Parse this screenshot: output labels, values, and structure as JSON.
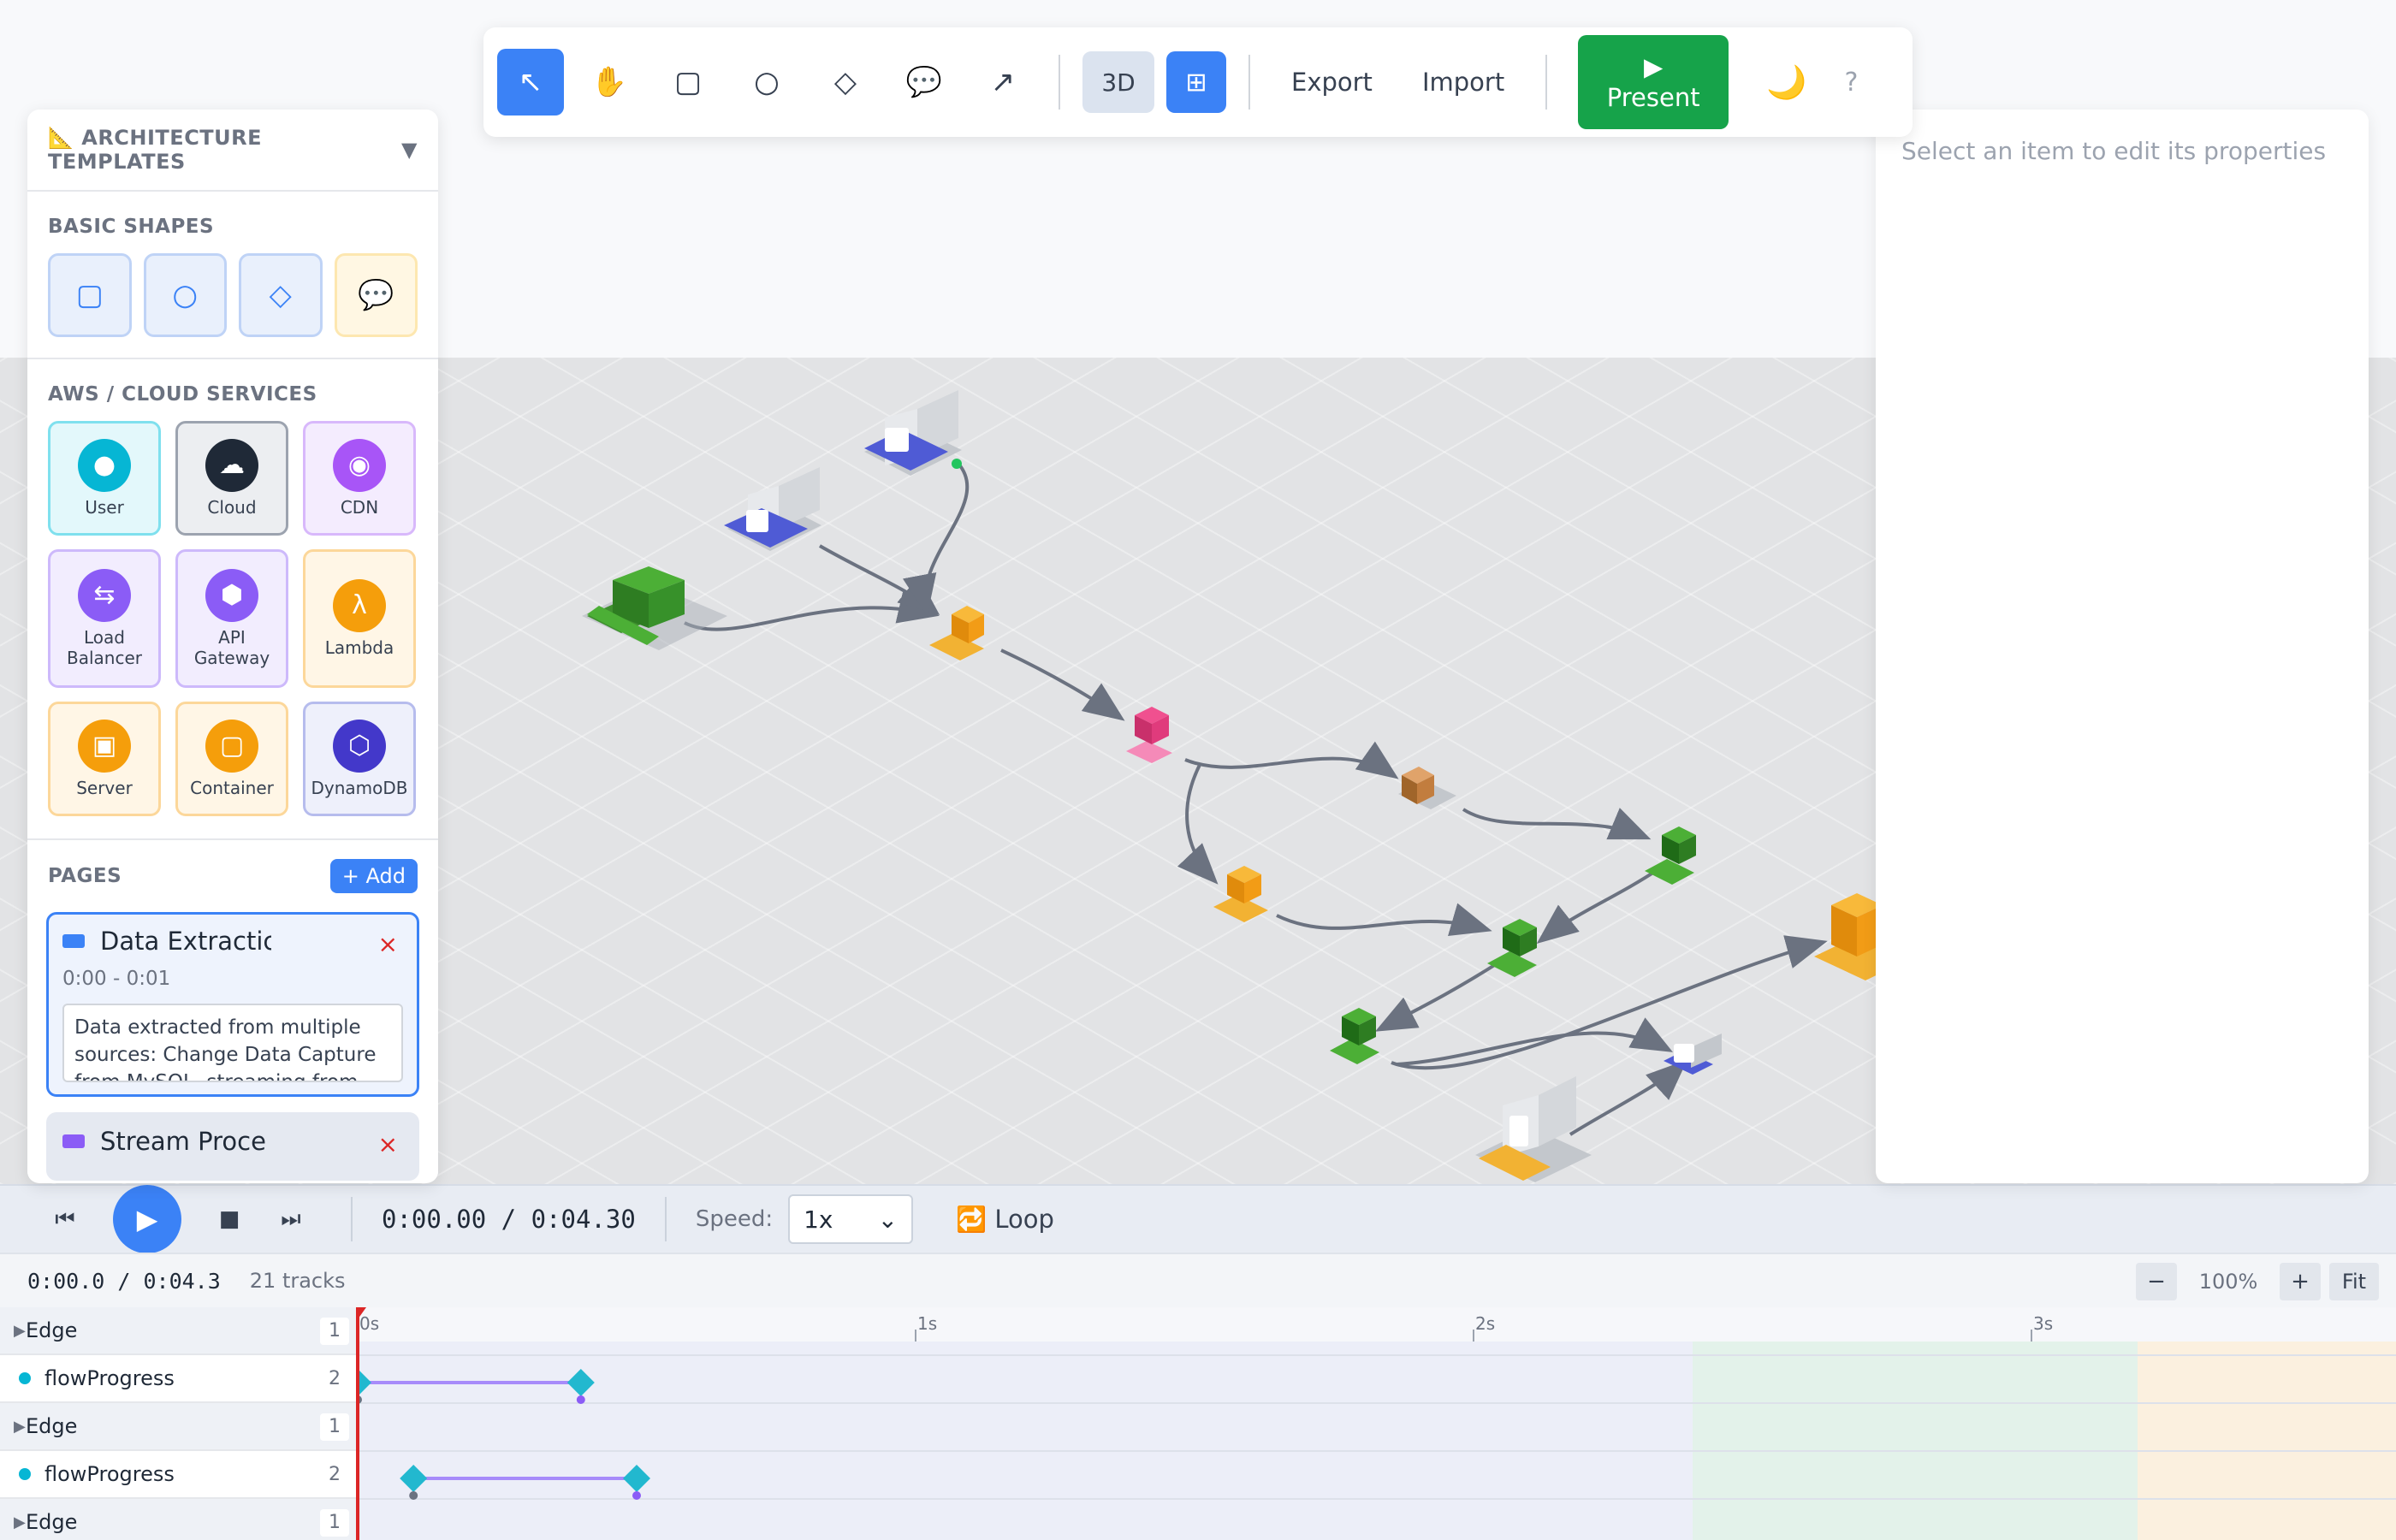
{
  "toolbar": {
    "tools": [
      {
        "name": "select-tool",
        "icon": "↖",
        "active": true
      },
      {
        "name": "pan-tool",
        "icon": "✋",
        "active": false
      },
      {
        "name": "rectangle-tool",
        "icon": "▢",
        "active": false
      },
      {
        "name": "circle-tool",
        "icon": "○",
        "active": false
      },
      {
        "name": "diamond-tool",
        "icon": "◇",
        "active": false
      },
      {
        "name": "note-tool",
        "icon": "💬",
        "active": false
      },
      {
        "name": "arrow-tool",
        "icon": "↗",
        "active": false
      }
    ],
    "view_3d": "3D",
    "grid_icon": "⊞",
    "export": "Export",
    "import": "Import",
    "present_icon": "▶",
    "present": "Present",
    "theme_icon": "🌙",
    "help": "?"
  },
  "left_panel": {
    "header": "📐 ARCHITECTURE TEMPLATES",
    "header_toggle": "▼",
    "basic_shapes_title": "BASIC SHAPES",
    "basic_shapes": [
      "▢",
      "○",
      "◇",
      "💬"
    ],
    "services_title": "AWS / CLOUD SERVICES",
    "services": [
      {
        "label": "User",
        "icon": "●",
        "color": "#06b6d4",
        "bg": "#e3f8fb",
        "border": "#7fe0ee"
      },
      {
        "label": "Cloud",
        "icon": "☁",
        "color": "#1f2937",
        "bg": "#eceef1",
        "border": "#9ca3af"
      },
      {
        "label": "CDN",
        "icon": "◉",
        "color": "#a855f7",
        "bg": "#f4ecfe",
        "border": "#d8b8fb"
      },
      {
        "label": "Load Balancer",
        "icon": "⇆",
        "color": "#8b5cf6",
        "bg": "#f2edfe",
        "border": "#cdb9fb"
      },
      {
        "label": "API Gateway",
        "icon": "⬢",
        "color": "#8b5cf6",
        "bg": "#f2edfe",
        "border": "#cdb9fb"
      },
      {
        "label": "Lambda",
        "icon": "λ",
        "color": "#f59e0b",
        "bg": "#fff6e6",
        "border": "#fcd79a"
      },
      {
        "label": "Server",
        "icon": "▣",
        "color": "#f59e0b",
        "bg": "#fff6e6",
        "border": "#fcd79a"
      },
      {
        "label": "Container",
        "icon": "▢",
        "color": "#f59e0b",
        "bg": "#fff6e6",
        "border": "#fcd79a"
      },
      {
        "label": "DynamoDB",
        "icon": "⬡",
        "color": "#4338ca",
        "bg": "#eef0fb",
        "border": "#b6bced"
      }
    ],
    "pages_title": "PAGES",
    "add_label": "+ Add",
    "pages": [
      {
        "title": "Data Extractic",
        "time": "0:00 - 0:01",
        "color": "#3b82f6",
        "description": "Data extracted from multiple sources: Change Data Capture from MySQL, streaming from",
        "close": "×"
      },
      {
        "title": "Stream Proce",
        "color": "#8b5cf6",
        "close": "×"
      }
    ]
  },
  "right_panel": {
    "hint": "Select an item to edit its properties"
  },
  "playback": {
    "skip_back": "⏮",
    "play": "▶",
    "stop": "■",
    "skip_forward": "⏭",
    "time": "0:00.00 / 0:04.30",
    "speed_label": "Speed:",
    "speed_value": "1x",
    "loop": "🔁 Loop"
  },
  "timeline": {
    "time": "0:00.0 / 0:04.3",
    "tracks": "21 tracks",
    "zoom_out": "−",
    "zoom": "100%",
    "zoom_in": "+",
    "fit": "Fit",
    "ticks": [
      "0s",
      "1s",
      "2s",
      "3s"
    ],
    "rows": [
      {
        "label": "Edge",
        "count": "1",
        "kind": "group"
      },
      {
        "label": "flowProgress",
        "count": "2",
        "kind": "prop"
      },
      {
        "label": "Edge",
        "count": "1",
        "kind": "group"
      },
      {
        "label": "flowProgress",
        "count": "2",
        "kind": "prop"
      },
      {
        "label": "Edge",
        "count": "1",
        "kind": "group"
      }
    ],
    "keyframes": [
      {
        "row": 1,
        "start_s": 0.0,
        "end_s": 0.4
      },
      {
        "row": 3,
        "start_s": 0.1,
        "end_s": 0.5
      }
    ]
  },
  "colors": {
    "accent": "#3b82f6",
    "present": "#16a34a",
    "edge": "#6b7280"
  }
}
